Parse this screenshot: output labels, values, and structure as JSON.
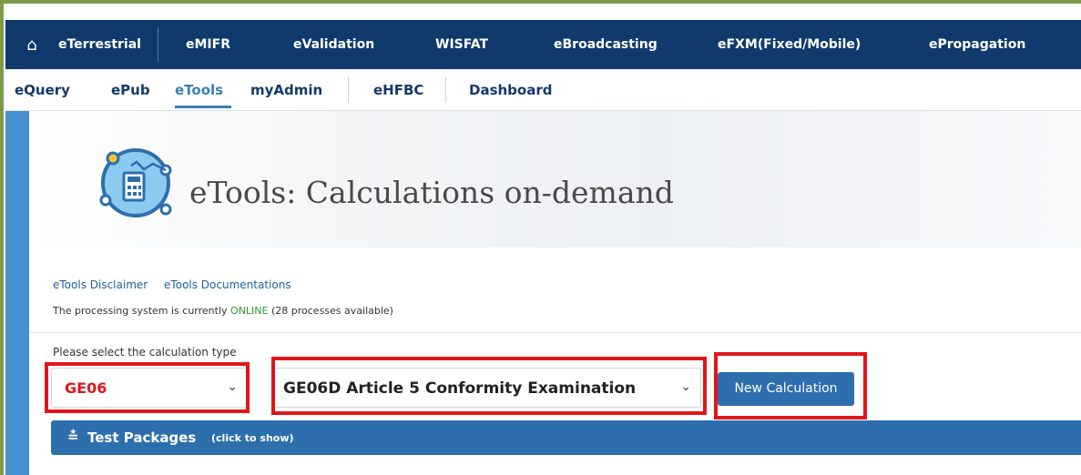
{
  "topnav": {
    "items": [
      "eTerrestrial",
      "eMIFR",
      "eValidation",
      "WISFAT",
      "eBroadcasting",
      "eFXM(Fixed/Mobile)",
      "ePropagation"
    ],
    "home_icon": "home-icon"
  },
  "subnav": {
    "items": [
      "eQuery",
      "ePub",
      "eTools",
      "myAdmin",
      "eHFBC",
      "Dashboard"
    ],
    "active": "eTools"
  },
  "page": {
    "title": "eTools: Calculations on-demand",
    "logo_icon": "calculator-network-icon"
  },
  "links": {
    "disclaimer": "eTools Disclaimer",
    "documentations": "eTools Documentations"
  },
  "status": {
    "prefix": "The processing system is currently ",
    "state": "ONLINE",
    "suffix": " (28 processes available)"
  },
  "form": {
    "select_label": "Please select the calculation type",
    "type_value": "GE06",
    "subtype_value": "GE06D Article 5 Conformity Examination",
    "new_calc_label": "New Calculation"
  },
  "test_packages": {
    "title": "Test Packages",
    "hint": "(click to show)"
  },
  "colors": {
    "nav_bg": "#0f3a6b",
    "accent": "#2d6fad",
    "highlight": "#e0161b",
    "online": "#2a9a2a"
  }
}
